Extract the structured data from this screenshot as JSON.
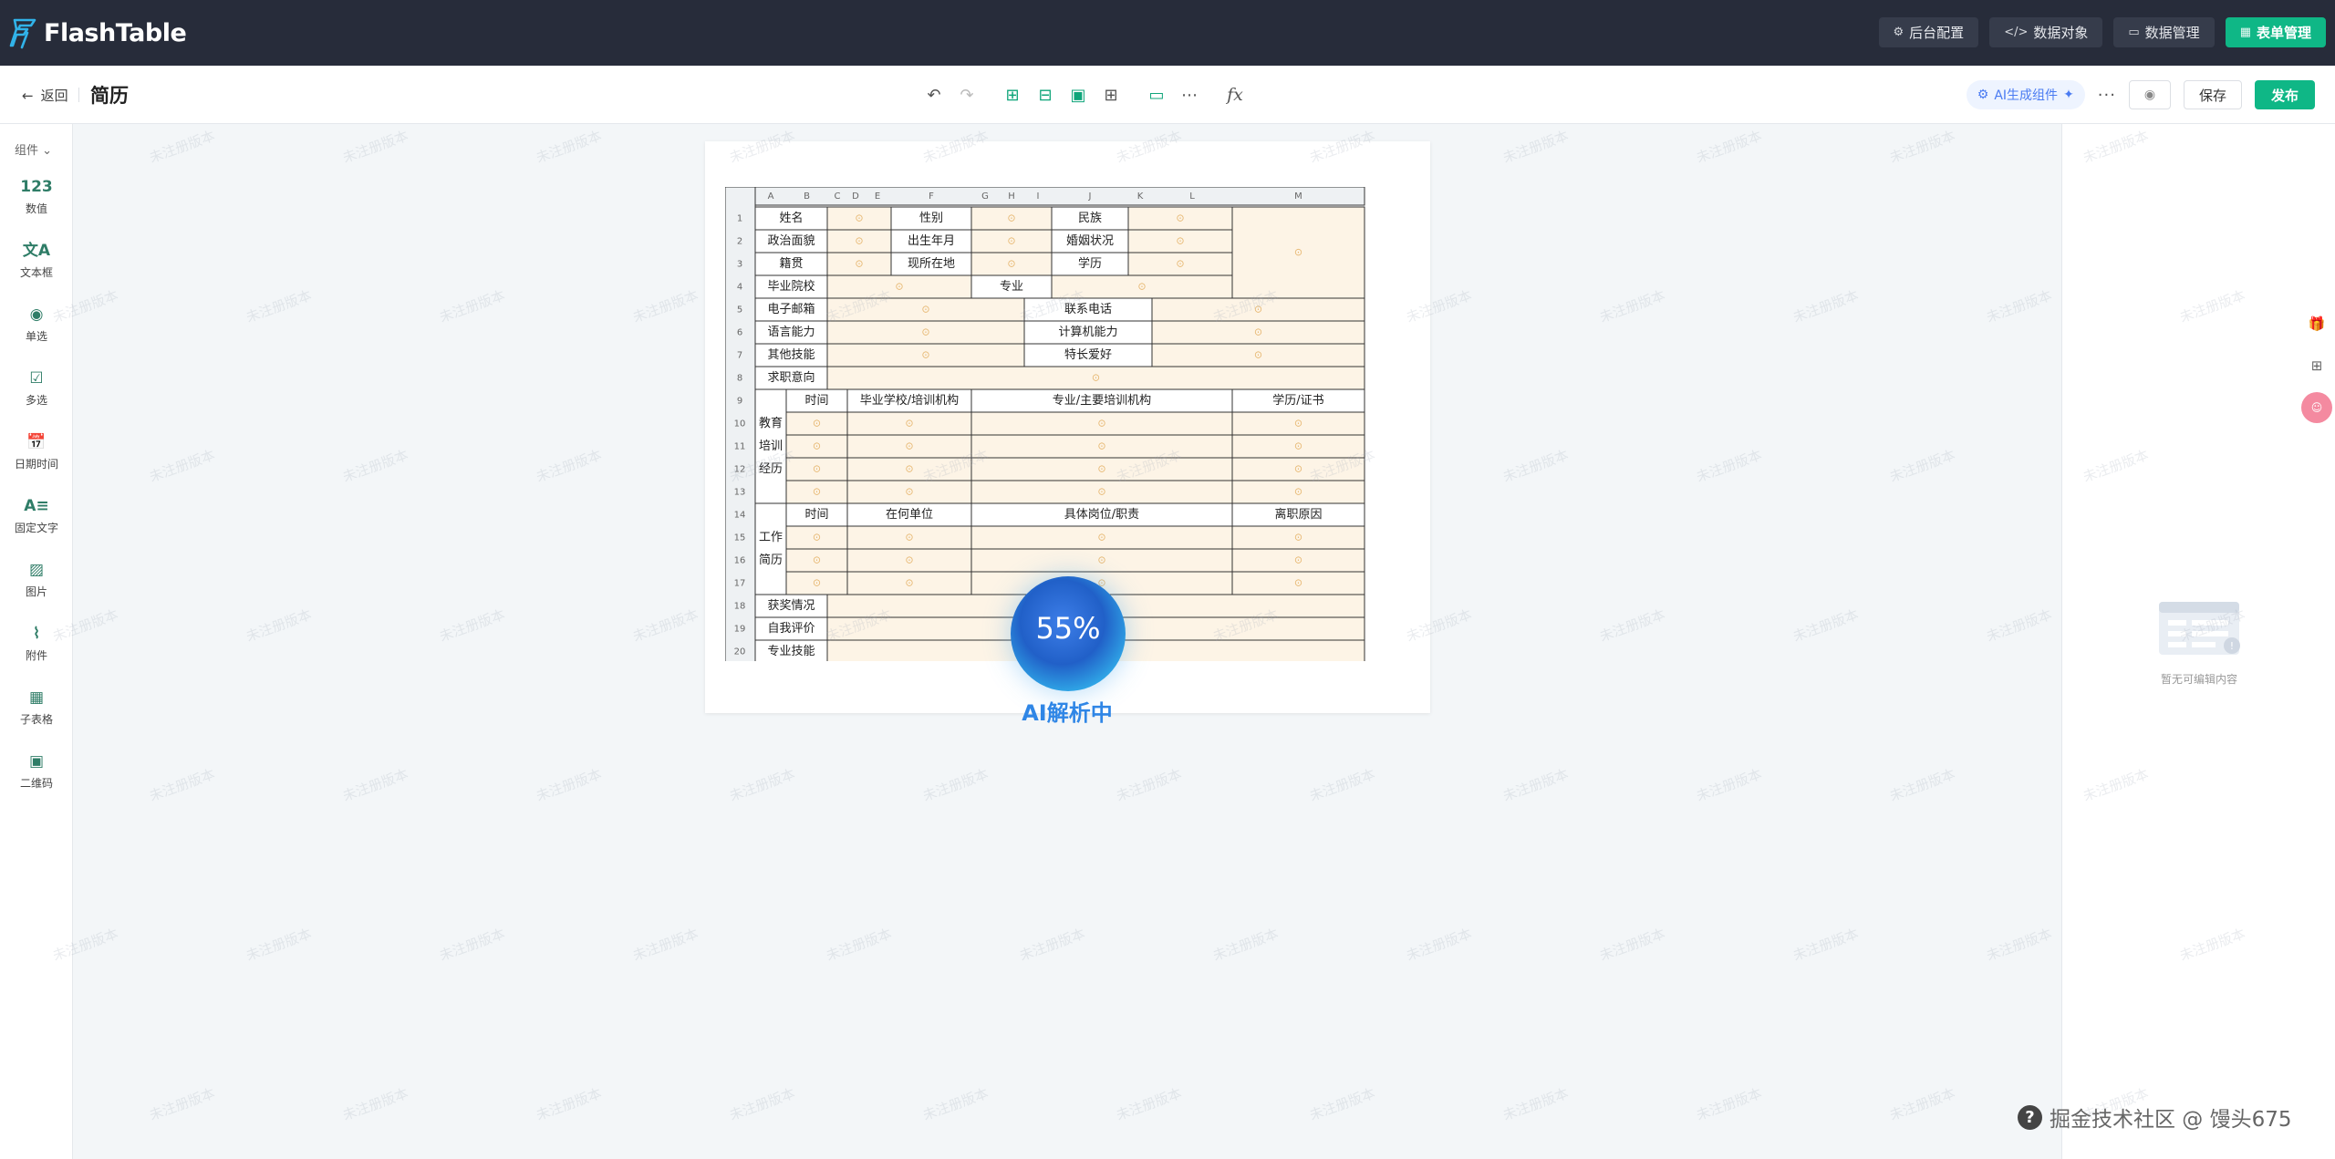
{
  "app": {
    "name": "FlashTable"
  },
  "topbar": {
    "buttons": [
      {
        "label": "后台配置",
        "icon": "gear-icon"
      },
      {
        "label": "数据对象",
        "icon": "code-icon"
      },
      {
        "label": "数据管理",
        "icon": "database-icon"
      },
      {
        "label": "表单管理",
        "icon": "grid-icon",
        "primary": true
      }
    ]
  },
  "subbar": {
    "back_label": "返回",
    "title": "简历",
    "ai_label": "AI生成组件",
    "save_label": "保存",
    "publish_label": "发布"
  },
  "sidebar": {
    "header": "组件",
    "items": [
      {
        "label": "数值",
        "icon": "number-icon",
        "glyph": "123"
      },
      {
        "label": "文本框",
        "icon": "text-icon",
        "glyph": "文A"
      },
      {
        "label": "单选",
        "icon": "radio-icon",
        "glyph": "◉"
      },
      {
        "label": "多选",
        "icon": "checkbox-icon",
        "glyph": "☑"
      },
      {
        "label": "日期时间",
        "icon": "calendar-icon",
        "glyph": "📅"
      },
      {
        "label": "固定文字",
        "icon": "fixed-text-icon",
        "glyph": "A≡"
      },
      {
        "label": "图片",
        "icon": "image-icon",
        "glyph": "▨"
      },
      {
        "label": "附件",
        "icon": "paperclip-icon",
        "glyph": "⌇"
      },
      {
        "label": "子表格",
        "icon": "subtable-icon",
        "glyph": "▦"
      },
      {
        "label": "二维码",
        "icon": "qrcode-icon",
        "glyph": "▣"
      }
    ]
  },
  "sheet": {
    "col_letters": [
      "A",
      "B",
      "C",
      "D",
      "E",
      "F",
      "G",
      "H",
      "I",
      "J",
      "K",
      "L",
      "M"
    ],
    "row_numbers": [
      "1",
      "2",
      "3",
      "4",
      "5",
      "6",
      "7",
      "8",
      "9",
      "10",
      "11",
      "12",
      "13",
      "14",
      "15",
      "16",
      "17",
      "18",
      "19",
      "20"
    ],
    "labels": {
      "name": "姓名",
      "gender": "性别",
      "ethnicity": "民族",
      "political": "政治面貌",
      "birth": "出生年月",
      "marital": "婚姻状况",
      "native": "籍贯",
      "location": "现所在地",
      "degree": "学历",
      "school": "毕业院校",
      "major": "专业",
      "email": "电子邮箱",
      "phone": "联系电话",
      "language": "语言能力",
      "computer": "计算机能力",
      "other_skills": "其他技能",
      "hobby": "特长爱好",
      "intent": "求职意向",
      "edu_group": "教育培训经历",
      "edu_time": "时间",
      "edu_school": "毕业学校/培训机构",
      "edu_major": "专业/主要培训机构",
      "edu_cert": "学历/证书",
      "work_group": "工作简历",
      "work_time": "时间",
      "work_company": "在何单位",
      "work_role": "具体岗位/职责",
      "work_leave": "离职原因",
      "awards": "获奖情况",
      "self_eval": "自我评价",
      "skills": "专业技能"
    }
  },
  "loader": {
    "percent": 0.55,
    "percent_label": "55%",
    "text": "AI解析中"
  },
  "rightpanel": {
    "empty_text": "暂无可编辑内容"
  },
  "watermark": {
    "text": "未注册版本"
  },
  "community": {
    "text": "掘金技术社区 @ 馒头675"
  }
}
